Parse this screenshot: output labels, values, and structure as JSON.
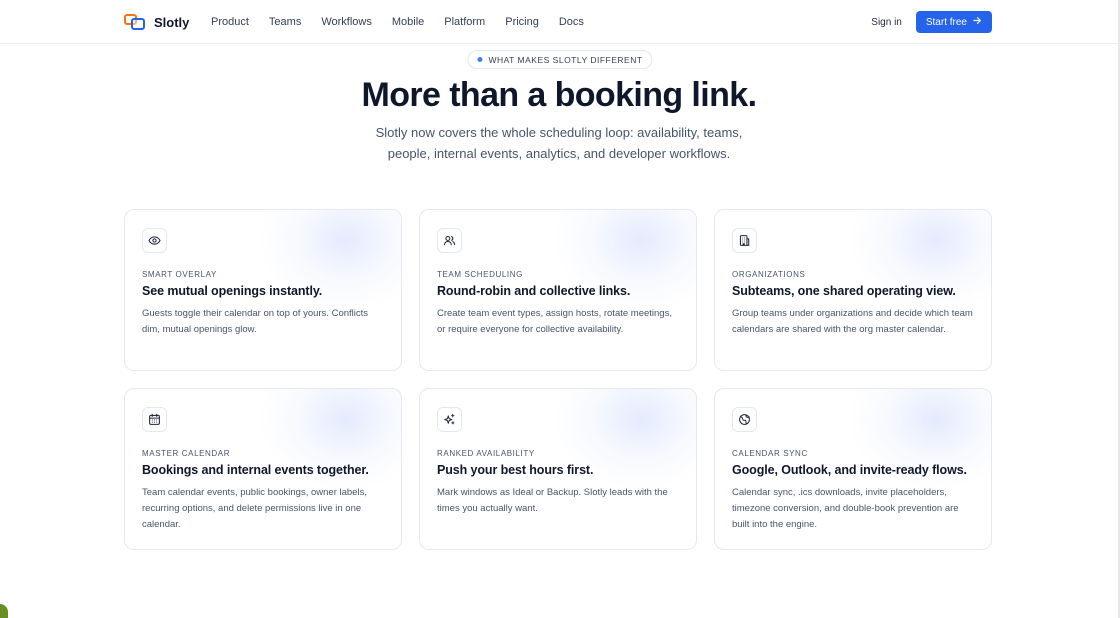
{
  "nav": {
    "logo_text": "Slotly",
    "links": [
      "Product",
      "Teams",
      "Workflows",
      "Mobile",
      "Platform",
      "Pricing",
      "Docs"
    ],
    "sign_in": "Sign in",
    "start_free": "Start free",
    "accent": "#2563eb"
  },
  "hero": {
    "badge": "WHAT MAKES SLOTLY DIFFERENT",
    "title": "More than a booking link.",
    "subtitle": "Slotly now covers the whole scheduling loop: availability, teams, people, internal events, analytics, and developer workflows."
  },
  "cards": [
    {
      "icon": "eye-icon",
      "label": "SMART OVERLAY",
      "title": "See mutual openings instantly.",
      "desc": "Guests toggle their calendar on top of yours. Conflicts dim, mutual openings glow."
    },
    {
      "icon": "users-icon",
      "label": "TEAM SCHEDULING",
      "title": "Round-robin and collective links.",
      "desc": "Create team event types, assign hosts, rotate meetings, or require everyone for collective availability."
    },
    {
      "icon": "building-icon",
      "label": "ORGANIZATIONS",
      "title": "Subteams, one shared operating view.",
      "desc": "Group teams under organizations and decide which team calendars are shared with the org master calendar."
    },
    {
      "icon": "calendar-icon",
      "label": "MASTER CALENDAR",
      "title": "Bookings and internal events together.",
      "desc": "Team calendar events, public bookings, owner labels, recurring options, and delete permissions live in one calendar."
    },
    {
      "icon": "sparkles-icon",
      "label": "RANKED AVAILABILITY",
      "title": "Push your best hours first.",
      "desc": "Mark windows as Ideal or Backup. Slotly leads with the times you actually want."
    },
    {
      "icon": "globe-icon",
      "label": "CALENDAR SYNC",
      "title": "Google, Outlook, and invite-ready flows.",
      "desc": "Calendar sync, .ics downloads, invite placeholders, timezone conversion, and double-book prevention are built into the engine."
    }
  ]
}
